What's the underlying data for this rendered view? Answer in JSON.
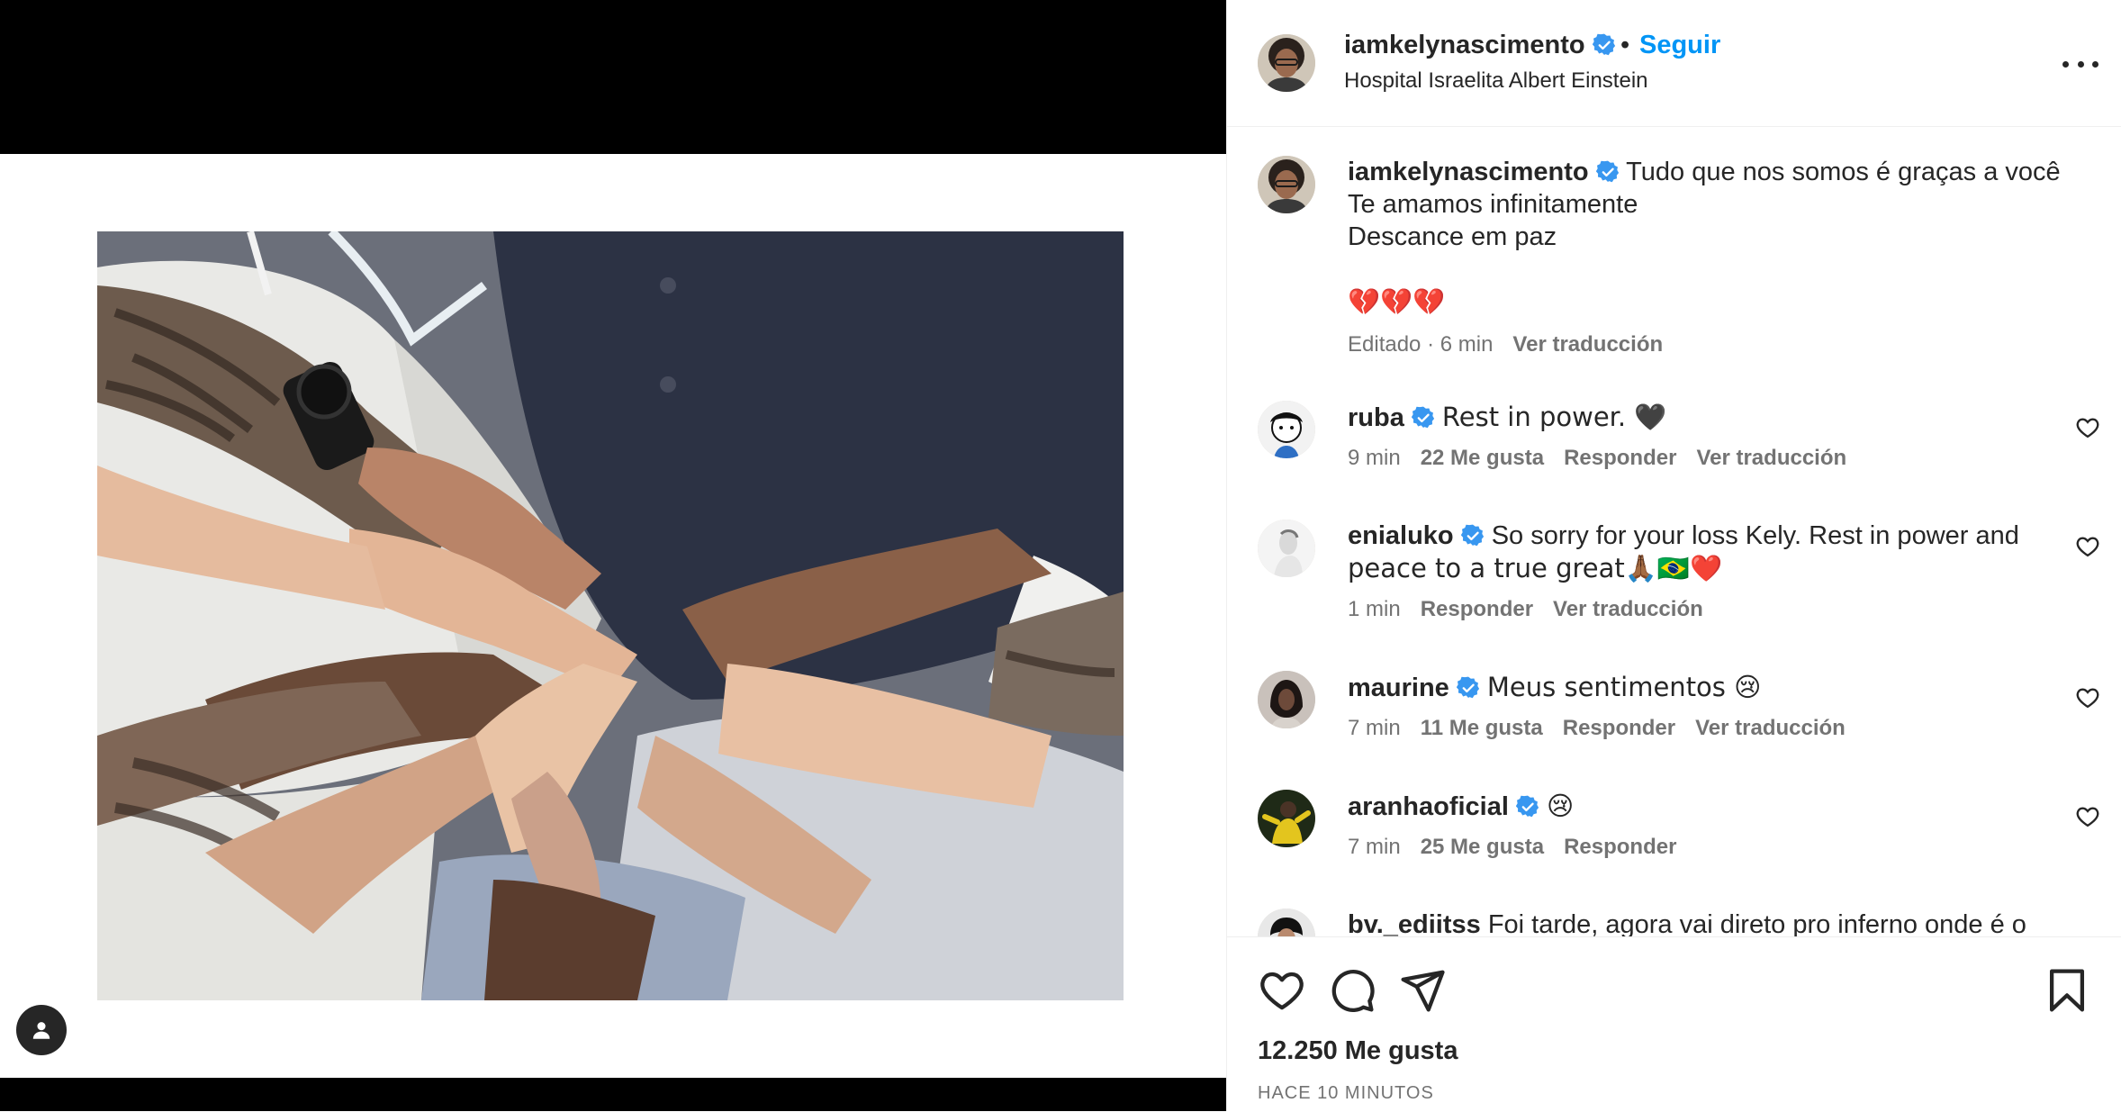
{
  "header": {
    "username": "iamkelynascimento",
    "separator": "•",
    "follow_label": "Seguir",
    "location": "Hospital Israelita Albert Einstein"
  },
  "caption": {
    "username": "iamkelynascimento",
    "line1": "Tudo que nos somos é graças a você",
    "line2": "Te amamos infinitamente",
    "line3": "Descance em paz",
    "emoji": "💔💔💔",
    "edited": "Editado · 6 min",
    "translate": "Ver traducción"
  },
  "comments": [
    {
      "username": "ruba",
      "text": "Rest in power. 🖤",
      "time": "9 min",
      "likes": "22 Me gusta",
      "reply": "Responder",
      "translate": "Ver traducción"
    },
    {
      "username": "enialuko",
      "text_line1": "So sorry for your loss Kely. Rest in power and",
      "text_line2": "peace to a true great🙏🏾🇧🇷❤️",
      "time": "1 min",
      "reply": "Responder",
      "translate": "Ver traducción"
    },
    {
      "username": "maurine",
      "text": "Meus sentimentos 😢",
      "time": "7 min",
      "likes": "11 Me gusta",
      "reply": "Responder",
      "translate": "Ver traducción"
    },
    {
      "username": "aranhaoficial",
      "text": "😢",
      "time": "7 min",
      "likes": "25 Me gusta",
      "reply": "Responder"
    },
    {
      "username": "bv._ediitss",
      "text": "Foi tarde, agora vai direto pro inferno onde é o"
    }
  ],
  "footer": {
    "likes": "12.250 Me gusta",
    "time": "HACE 10 MINUTOS"
  },
  "icons": {
    "like": "heart-icon",
    "comment": "comment-icon",
    "share": "share-icon",
    "save": "bookmark-icon",
    "verified": "verified-badge-icon",
    "more": "more-options-icon",
    "tag": "user-tag-icon"
  },
  "colors": {
    "accent": "#0095f6",
    "verified": "#3897f0",
    "text": "#262626",
    "secondary": "#737373"
  }
}
